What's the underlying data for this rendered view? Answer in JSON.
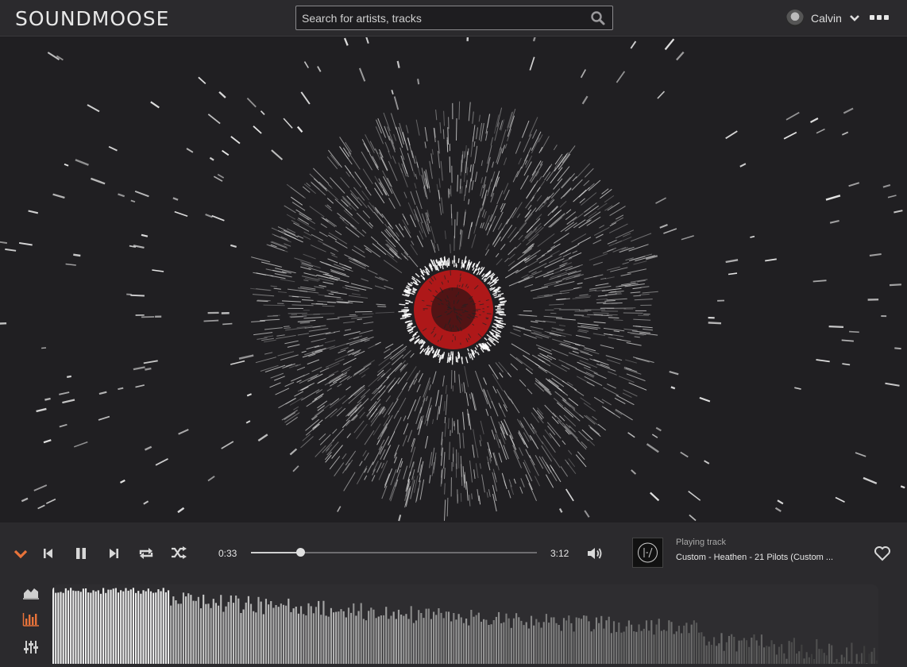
{
  "app": {
    "logo": "SOUNDMOOSE"
  },
  "search": {
    "placeholder": "Search for artists, tracks"
  },
  "user": {
    "name": "Calvin"
  },
  "colors": {
    "accent": "#e8733a",
    "ring_red": "#c81818",
    "text": "#e6e6e6"
  },
  "player": {
    "elapsed": "0:33",
    "duration": "3:12",
    "progress": 0.172,
    "playing_label": "Playing track",
    "track_title": "Custom - Heathen - 21 Pilots (Custom ...",
    "state": "playing",
    "icons": [
      "collapse-chevron-icon",
      "previous-icon",
      "pause-icon",
      "next-icon",
      "repeat-icon",
      "shuffle-icon",
      "volume-icon",
      "heart-icon"
    ]
  },
  "visualizer_modes": [
    {
      "name": "area-chart-icon",
      "active": false
    },
    {
      "name": "bar-chart-icon",
      "active": true
    },
    {
      "name": "equalizer-icon",
      "active": false
    }
  ]
}
